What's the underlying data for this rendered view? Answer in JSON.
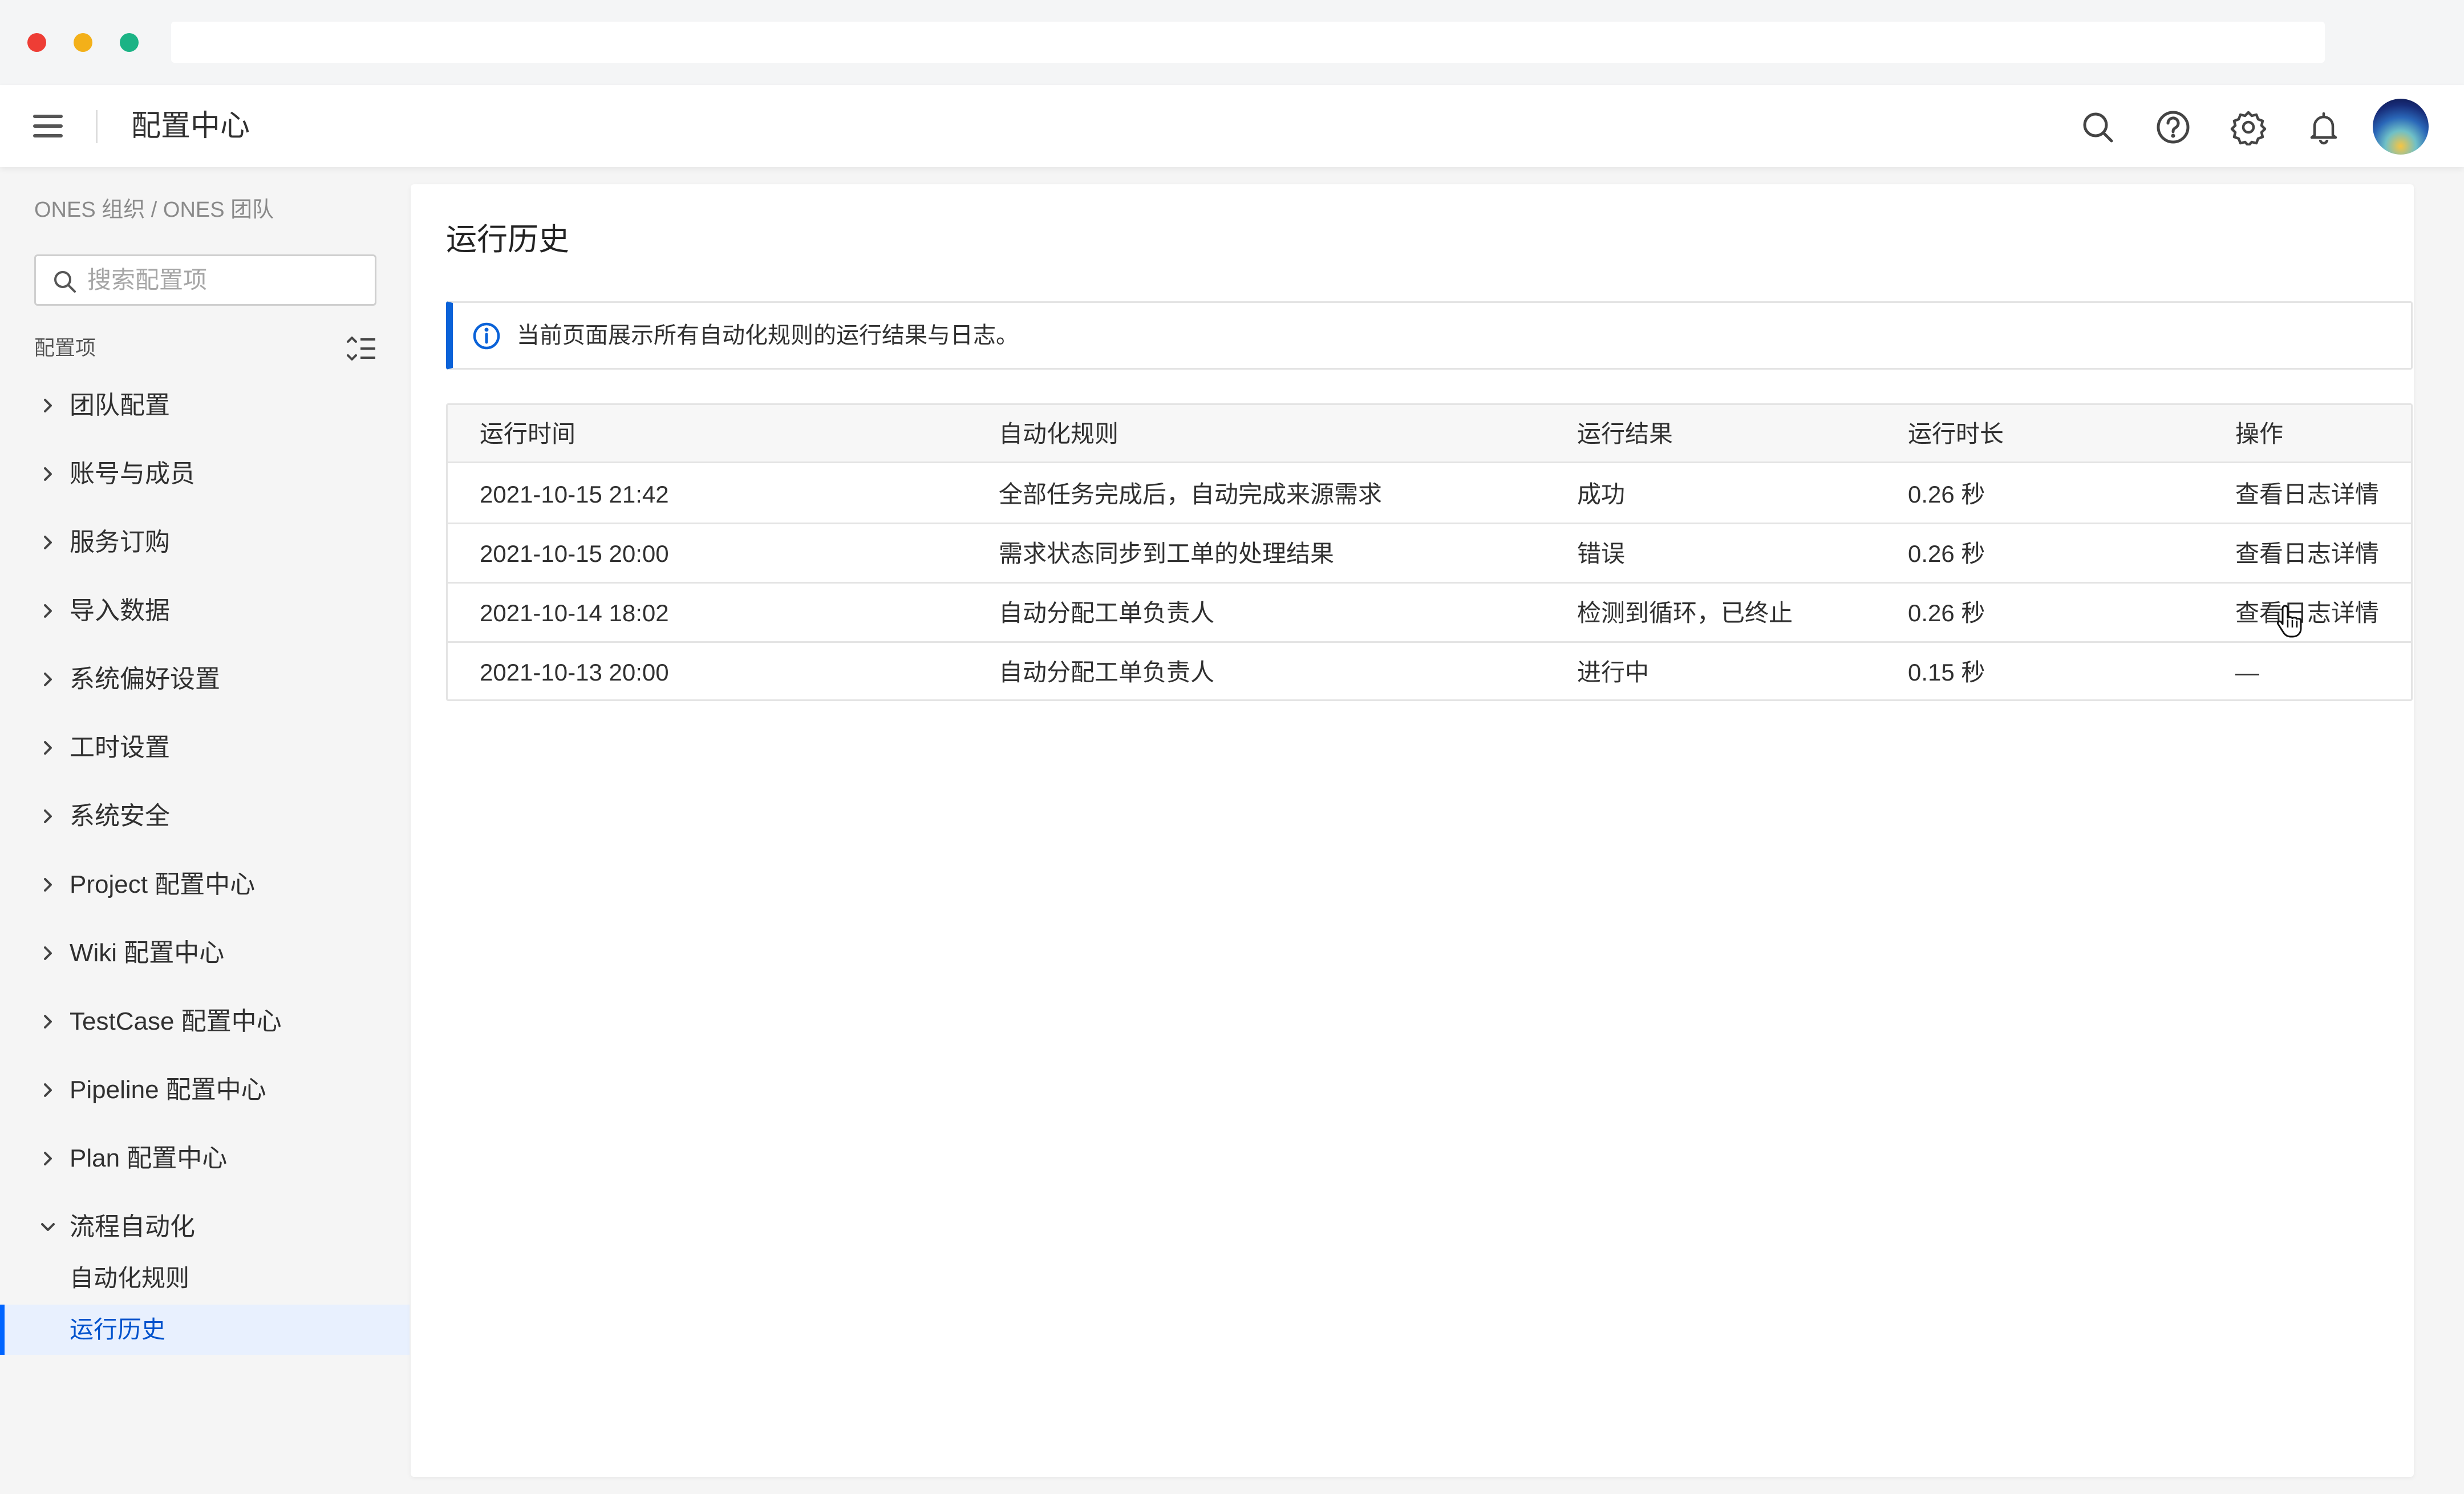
{
  "header": {
    "title": "配置中心",
    "icons": [
      "search-icon",
      "help-icon",
      "gear-icon",
      "bell-icon",
      "avatar"
    ]
  },
  "sidebar": {
    "breadcrumb": "ONES 组织 / ONES 团队",
    "search_placeholder": "搜索配置项",
    "section_label": "配置项",
    "items": [
      {
        "label": "团队配置"
      },
      {
        "label": "账号与成员"
      },
      {
        "label": "服务订购"
      },
      {
        "label": "导入数据"
      },
      {
        "label": "系统偏好设置"
      },
      {
        "label": "工时设置"
      },
      {
        "label": "系统安全"
      },
      {
        "label": "Project 配置中心"
      },
      {
        "label": "Wiki 配置中心"
      },
      {
        "label": "TestCase 配置中心"
      },
      {
        "label": "Pipeline 配置中心"
      },
      {
        "label": "Plan 配置中心"
      },
      {
        "label": "流程自动化",
        "expanded": true
      }
    ],
    "sub_items": [
      {
        "label": "自动化规则",
        "active": false
      },
      {
        "label": "运行历史",
        "active": true
      }
    ]
  },
  "main": {
    "title": "运行历史",
    "info": "当前页面展示所有自动化规则的运行结果与日志。",
    "table": {
      "columns": [
        "运行时间",
        "自动化规则",
        "运行结果",
        "运行时长",
        "操作"
      ],
      "rows": [
        {
          "time": "2021-10-15 21:42",
          "rule": "全部任务完成后，自动完成来源需求",
          "result": "成功",
          "duration": "0.26 秒",
          "action": "查看日志详情"
        },
        {
          "time": "2021-10-15 20:00",
          "rule": "需求状态同步到工单的处理结果",
          "result": "错误",
          "duration": "0.26 秒",
          "action": "查看日志详情"
        },
        {
          "time": "2021-10-14 18:02",
          "rule": "自动分配工单负责人",
          "result": "检测到循环，已终止",
          "duration": "0.26 秒",
          "action": "查看日志详情"
        },
        {
          "time": "2021-10-13 20:00",
          "rule": "自动分配工单负责人",
          "result": "进行中",
          "duration": "0.15 秒",
          "action": "—"
        }
      ]
    }
  },
  "colors": {
    "accent": "#0a62d8",
    "active_bg": "#e8f0fe"
  }
}
